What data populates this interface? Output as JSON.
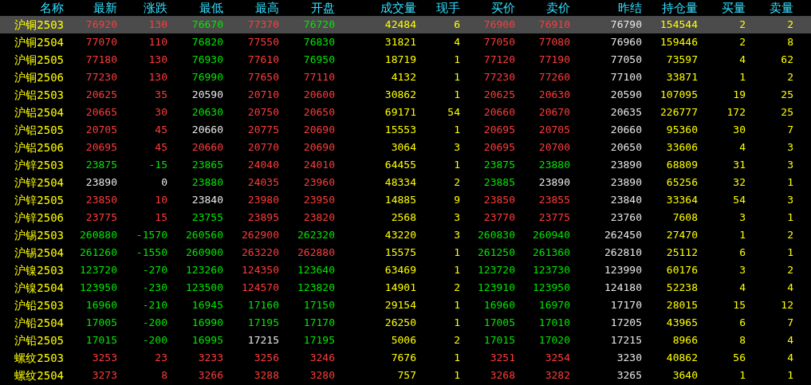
{
  "columns": [
    "名称",
    "最新",
    "涨跌",
    "最低",
    "最高",
    "开盘",
    "成交量",
    "现手",
    "买价",
    "卖价",
    "昨结",
    "持仓量",
    "买量",
    "卖量"
  ],
  "rows": [
    {
      "name": "沪铜2503",
      "selected": true,
      "cells": [
        {
          "text": "76920",
          "color": "#ff3c3c"
        },
        {
          "text": "130",
          "color": "#ff3c3c"
        },
        {
          "text": "76670",
          "color": "#00e800"
        },
        {
          "text": "77370",
          "color": "#ff3c3c"
        },
        {
          "text": "76720",
          "color": "#00e800"
        },
        {
          "text": "42484",
          "color": "#ffff00"
        },
        {
          "text": "6",
          "color": "#ffff00"
        },
        {
          "text": "76900",
          "color": "#ff3c3c"
        },
        {
          "text": "76910",
          "color": "#ff3c3c"
        },
        {
          "text": "76790",
          "color": "#e8e8e8"
        },
        {
          "text": "154544",
          "color": "#ffff00"
        },
        {
          "text": "2",
          "color": "#ffff00"
        },
        {
          "text": "2",
          "color": "#ffff00"
        }
      ]
    },
    {
      "name": "沪铜2504",
      "selected": false,
      "cells": [
        {
          "text": "77070",
          "color": "#ff3c3c"
        },
        {
          "text": "110",
          "color": "#ff3c3c"
        },
        {
          "text": "76820",
          "color": "#00e800"
        },
        {
          "text": "77550",
          "color": "#ff3c3c"
        },
        {
          "text": "76830",
          "color": "#00e800"
        },
        {
          "text": "31821",
          "color": "#ffff00"
        },
        {
          "text": "4",
          "color": "#ffff00"
        },
        {
          "text": "77050",
          "color": "#ff3c3c"
        },
        {
          "text": "77080",
          "color": "#ff3c3c"
        },
        {
          "text": "76960",
          "color": "#e8e8e8"
        },
        {
          "text": "159446",
          "color": "#ffff00"
        },
        {
          "text": "2",
          "color": "#ffff00"
        },
        {
          "text": "8",
          "color": "#ffff00"
        }
      ]
    },
    {
      "name": "沪铜2505",
      "selected": false,
      "cells": [
        {
          "text": "77180",
          "color": "#ff3c3c"
        },
        {
          "text": "130",
          "color": "#ff3c3c"
        },
        {
          "text": "76930",
          "color": "#00e800"
        },
        {
          "text": "77610",
          "color": "#ff3c3c"
        },
        {
          "text": "76950",
          "color": "#00e800"
        },
        {
          "text": "18719",
          "color": "#ffff00"
        },
        {
          "text": "1",
          "color": "#ffff00"
        },
        {
          "text": "77120",
          "color": "#ff3c3c"
        },
        {
          "text": "77190",
          "color": "#ff3c3c"
        },
        {
          "text": "77050",
          "color": "#e8e8e8"
        },
        {
          "text": "73597",
          "color": "#ffff00"
        },
        {
          "text": "4",
          "color": "#ffff00"
        },
        {
          "text": "62",
          "color": "#ffff00"
        }
      ]
    },
    {
      "name": "沪铜2506",
      "selected": false,
      "cells": [
        {
          "text": "77230",
          "color": "#ff3c3c"
        },
        {
          "text": "130",
          "color": "#ff3c3c"
        },
        {
          "text": "76990",
          "color": "#00e800"
        },
        {
          "text": "77650",
          "color": "#ff3c3c"
        },
        {
          "text": "77110",
          "color": "#ff3c3c"
        },
        {
          "text": "4132",
          "color": "#ffff00"
        },
        {
          "text": "1",
          "color": "#ffff00"
        },
        {
          "text": "77230",
          "color": "#ff3c3c"
        },
        {
          "text": "77260",
          "color": "#ff3c3c"
        },
        {
          "text": "77100",
          "color": "#e8e8e8"
        },
        {
          "text": "33871",
          "color": "#ffff00"
        },
        {
          "text": "1",
          "color": "#ffff00"
        },
        {
          "text": "2",
          "color": "#ffff00"
        }
      ]
    },
    {
      "name": "沪铝2503",
      "selected": false,
      "cells": [
        {
          "text": "20625",
          "color": "#ff3c3c"
        },
        {
          "text": "35",
          "color": "#ff3c3c"
        },
        {
          "text": "20590",
          "color": "#e8e8e8"
        },
        {
          "text": "20710",
          "color": "#ff3c3c"
        },
        {
          "text": "20600",
          "color": "#ff3c3c"
        },
        {
          "text": "30862",
          "color": "#ffff00"
        },
        {
          "text": "1",
          "color": "#ffff00"
        },
        {
          "text": "20625",
          "color": "#ff3c3c"
        },
        {
          "text": "20630",
          "color": "#ff3c3c"
        },
        {
          "text": "20590",
          "color": "#e8e8e8"
        },
        {
          "text": "107095",
          "color": "#ffff00"
        },
        {
          "text": "19",
          "color": "#ffff00"
        },
        {
          "text": "25",
          "color": "#ffff00"
        }
      ]
    },
    {
      "name": "沪铝2504",
      "selected": false,
      "cells": [
        {
          "text": "20665",
          "color": "#ff3c3c"
        },
        {
          "text": "30",
          "color": "#ff3c3c"
        },
        {
          "text": "20630",
          "color": "#00e800"
        },
        {
          "text": "20750",
          "color": "#ff3c3c"
        },
        {
          "text": "20650",
          "color": "#ff3c3c"
        },
        {
          "text": "69171",
          "color": "#ffff00"
        },
        {
          "text": "54",
          "color": "#ffff00"
        },
        {
          "text": "20660",
          "color": "#ff3c3c"
        },
        {
          "text": "20670",
          "color": "#ff3c3c"
        },
        {
          "text": "20635",
          "color": "#e8e8e8"
        },
        {
          "text": "226777",
          "color": "#ffff00"
        },
        {
          "text": "172",
          "color": "#ffff00"
        },
        {
          "text": "25",
          "color": "#ffff00"
        }
      ]
    },
    {
      "name": "沪铝2505",
      "selected": false,
      "cells": [
        {
          "text": "20705",
          "color": "#ff3c3c"
        },
        {
          "text": "45",
          "color": "#ff3c3c"
        },
        {
          "text": "20660",
          "color": "#e8e8e8"
        },
        {
          "text": "20775",
          "color": "#ff3c3c"
        },
        {
          "text": "20690",
          "color": "#ff3c3c"
        },
        {
          "text": "15553",
          "color": "#ffff00"
        },
        {
          "text": "1",
          "color": "#ffff00"
        },
        {
          "text": "20695",
          "color": "#ff3c3c"
        },
        {
          "text": "20705",
          "color": "#ff3c3c"
        },
        {
          "text": "20660",
          "color": "#e8e8e8"
        },
        {
          "text": "95360",
          "color": "#ffff00"
        },
        {
          "text": "30",
          "color": "#ffff00"
        },
        {
          "text": "7",
          "color": "#ffff00"
        }
      ]
    },
    {
      "name": "沪铝2506",
      "selected": false,
      "cells": [
        {
          "text": "20695",
          "color": "#ff3c3c"
        },
        {
          "text": "45",
          "color": "#ff3c3c"
        },
        {
          "text": "20660",
          "color": "#ff3c3c"
        },
        {
          "text": "20770",
          "color": "#ff3c3c"
        },
        {
          "text": "20690",
          "color": "#ff3c3c"
        },
        {
          "text": "3064",
          "color": "#ffff00"
        },
        {
          "text": "3",
          "color": "#ffff00"
        },
        {
          "text": "20695",
          "color": "#ff3c3c"
        },
        {
          "text": "20700",
          "color": "#ff3c3c"
        },
        {
          "text": "20650",
          "color": "#e8e8e8"
        },
        {
          "text": "33606",
          "color": "#ffff00"
        },
        {
          "text": "4",
          "color": "#ffff00"
        },
        {
          "text": "3",
          "color": "#ffff00"
        }
      ]
    },
    {
      "name": "沪锌2503",
      "selected": false,
      "cells": [
        {
          "text": "23875",
          "color": "#00e800"
        },
        {
          "text": "-15",
          "color": "#00e800"
        },
        {
          "text": "23865",
          "color": "#00e800"
        },
        {
          "text": "24040",
          "color": "#ff3c3c"
        },
        {
          "text": "24010",
          "color": "#ff3c3c"
        },
        {
          "text": "64455",
          "color": "#ffff00"
        },
        {
          "text": "1",
          "color": "#ffff00"
        },
        {
          "text": "23875",
          "color": "#00e800"
        },
        {
          "text": "23880",
          "color": "#00e800"
        },
        {
          "text": "23890",
          "color": "#e8e8e8"
        },
        {
          "text": "68809",
          "color": "#ffff00"
        },
        {
          "text": "31",
          "color": "#ffff00"
        },
        {
          "text": "3",
          "color": "#ffff00"
        }
      ]
    },
    {
      "name": "沪锌2504",
      "selected": false,
      "cells": [
        {
          "text": "23890",
          "color": "#e8e8e8"
        },
        {
          "text": "0",
          "color": "#e8e8e8"
        },
        {
          "text": "23880",
          "color": "#00e800"
        },
        {
          "text": "24035",
          "color": "#ff3c3c"
        },
        {
          "text": "23960",
          "color": "#ff3c3c"
        },
        {
          "text": "48334",
          "color": "#ffff00"
        },
        {
          "text": "2",
          "color": "#ffff00"
        },
        {
          "text": "23885",
          "color": "#00e800"
        },
        {
          "text": "23890",
          "color": "#e8e8e8"
        },
        {
          "text": "23890",
          "color": "#e8e8e8"
        },
        {
          "text": "65256",
          "color": "#ffff00"
        },
        {
          "text": "32",
          "color": "#ffff00"
        },
        {
          "text": "1",
          "color": "#ffff00"
        }
      ]
    },
    {
      "name": "沪锌2505",
      "selected": false,
      "cells": [
        {
          "text": "23850",
          "color": "#ff3c3c"
        },
        {
          "text": "10",
          "color": "#ff3c3c"
        },
        {
          "text": "23840",
          "color": "#e8e8e8"
        },
        {
          "text": "23980",
          "color": "#ff3c3c"
        },
        {
          "text": "23950",
          "color": "#ff3c3c"
        },
        {
          "text": "14885",
          "color": "#ffff00"
        },
        {
          "text": "9",
          "color": "#ffff00"
        },
        {
          "text": "23850",
          "color": "#ff3c3c"
        },
        {
          "text": "23855",
          "color": "#ff3c3c"
        },
        {
          "text": "23840",
          "color": "#e8e8e8"
        },
        {
          "text": "33364",
          "color": "#ffff00"
        },
        {
          "text": "54",
          "color": "#ffff00"
        },
        {
          "text": "3",
          "color": "#ffff00"
        }
      ]
    },
    {
      "name": "沪锌2506",
      "selected": false,
      "cells": [
        {
          "text": "23775",
          "color": "#ff3c3c"
        },
        {
          "text": "15",
          "color": "#ff3c3c"
        },
        {
          "text": "23755",
          "color": "#00e800"
        },
        {
          "text": "23895",
          "color": "#ff3c3c"
        },
        {
          "text": "23820",
          "color": "#ff3c3c"
        },
        {
          "text": "2568",
          "color": "#ffff00"
        },
        {
          "text": "3",
          "color": "#ffff00"
        },
        {
          "text": "23770",
          "color": "#ff3c3c"
        },
        {
          "text": "23775",
          "color": "#ff3c3c"
        },
        {
          "text": "23760",
          "color": "#e8e8e8"
        },
        {
          "text": "7608",
          "color": "#ffff00"
        },
        {
          "text": "3",
          "color": "#ffff00"
        },
        {
          "text": "1",
          "color": "#ffff00"
        }
      ]
    },
    {
      "name": "沪锡2503",
      "selected": false,
      "cells": [
        {
          "text": "260880",
          "color": "#00e800"
        },
        {
          "text": "-1570",
          "color": "#00e800"
        },
        {
          "text": "260560",
          "color": "#00e800"
        },
        {
          "text": "262900",
          "color": "#ff3c3c"
        },
        {
          "text": "262320",
          "color": "#00e800"
        },
        {
          "text": "43220",
          "color": "#ffff00"
        },
        {
          "text": "3",
          "color": "#ffff00"
        },
        {
          "text": "260830",
          "color": "#00e800"
        },
        {
          "text": "260940",
          "color": "#00e800"
        },
        {
          "text": "262450",
          "color": "#e8e8e8"
        },
        {
          "text": "27470",
          "color": "#ffff00"
        },
        {
          "text": "1",
          "color": "#ffff00"
        },
        {
          "text": "2",
          "color": "#ffff00"
        }
      ]
    },
    {
      "name": "沪锡2504",
      "selected": false,
      "cells": [
        {
          "text": "261260",
          "color": "#00e800"
        },
        {
          "text": "-1550",
          "color": "#00e800"
        },
        {
          "text": "260900",
          "color": "#00e800"
        },
        {
          "text": "263220",
          "color": "#ff3c3c"
        },
        {
          "text": "262880",
          "color": "#ff3c3c"
        },
        {
          "text": "15575",
          "color": "#ffff00"
        },
        {
          "text": "1",
          "color": "#ffff00"
        },
        {
          "text": "261250",
          "color": "#00e800"
        },
        {
          "text": "261360",
          "color": "#00e800"
        },
        {
          "text": "262810",
          "color": "#e8e8e8"
        },
        {
          "text": "25112",
          "color": "#ffff00"
        },
        {
          "text": "6",
          "color": "#ffff00"
        },
        {
          "text": "1",
          "color": "#ffff00"
        }
      ]
    },
    {
      "name": "沪镍2503",
      "selected": false,
      "cells": [
        {
          "text": "123720",
          "color": "#00e800"
        },
        {
          "text": "-270",
          "color": "#00e800"
        },
        {
          "text": "123260",
          "color": "#00e800"
        },
        {
          "text": "124350",
          "color": "#ff3c3c"
        },
        {
          "text": "123640",
          "color": "#00e800"
        },
        {
          "text": "63469",
          "color": "#ffff00"
        },
        {
          "text": "1",
          "color": "#ffff00"
        },
        {
          "text": "123720",
          "color": "#00e800"
        },
        {
          "text": "123730",
          "color": "#00e800"
        },
        {
          "text": "123990",
          "color": "#e8e8e8"
        },
        {
          "text": "60176",
          "color": "#ffff00"
        },
        {
          "text": "3",
          "color": "#ffff00"
        },
        {
          "text": "2",
          "color": "#ffff00"
        }
      ]
    },
    {
      "name": "沪镍2504",
      "selected": false,
      "cells": [
        {
          "text": "123950",
          "color": "#00e800"
        },
        {
          "text": "-230",
          "color": "#00e800"
        },
        {
          "text": "123500",
          "color": "#00e800"
        },
        {
          "text": "124570",
          "color": "#ff3c3c"
        },
        {
          "text": "123820",
          "color": "#00e800"
        },
        {
          "text": "14901",
          "color": "#ffff00"
        },
        {
          "text": "2",
          "color": "#ffff00"
        },
        {
          "text": "123910",
          "color": "#00e800"
        },
        {
          "text": "123950",
          "color": "#00e800"
        },
        {
          "text": "124180",
          "color": "#e8e8e8"
        },
        {
          "text": "52238",
          "color": "#ffff00"
        },
        {
          "text": "4",
          "color": "#ffff00"
        },
        {
          "text": "4",
          "color": "#ffff00"
        }
      ]
    },
    {
      "name": "沪铅2503",
      "selected": false,
      "cells": [
        {
          "text": "16960",
          "color": "#00e800"
        },
        {
          "text": "-210",
          "color": "#00e800"
        },
        {
          "text": "16945",
          "color": "#00e800"
        },
        {
          "text": "17160",
          "color": "#00e800"
        },
        {
          "text": "17150",
          "color": "#00e800"
        },
        {
          "text": "29154",
          "color": "#ffff00"
        },
        {
          "text": "1",
          "color": "#ffff00"
        },
        {
          "text": "16960",
          "color": "#00e800"
        },
        {
          "text": "16970",
          "color": "#00e800"
        },
        {
          "text": "17170",
          "color": "#e8e8e8"
        },
        {
          "text": "28015",
          "color": "#ffff00"
        },
        {
          "text": "15",
          "color": "#ffff00"
        },
        {
          "text": "12",
          "color": "#ffff00"
        }
      ]
    },
    {
      "name": "沪铅2504",
      "selected": false,
      "cells": [
        {
          "text": "17005",
          "color": "#00e800"
        },
        {
          "text": "-200",
          "color": "#00e800"
        },
        {
          "text": "16990",
          "color": "#00e800"
        },
        {
          "text": "17195",
          "color": "#00e800"
        },
        {
          "text": "17170",
          "color": "#00e800"
        },
        {
          "text": "26250",
          "color": "#ffff00"
        },
        {
          "text": "1",
          "color": "#ffff00"
        },
        {
          "text": "17005",
          "color": "#00e800"
        },
        {
          "text": "17010",
          "color": "#00e800"
        },
        {
          "text": "17205",
          "color": "#e8e8e8"
        },
        {
          "text": "43965",
          "color": "#ffff00"
        },
        {
          "text": "6",
          "color": "#ffff00"
        },
        {
          "text": "7",
          "color": "#ffff00"
        }
      ]
    },
    {
      "name": "沪铅2505",
      "selected": false,
      "cells": [
        {
          "text": "17015",
          "color": "#00e800"
        },
        {
          "text": "-200",
          "color": "#00e800"
        },
        {
          "text": "16995",
          "color": "#00e800"
        },
        {
          "text": "17215",
          "color": "#e8e8e8"
        },
        {
          "text": "17195",
          "color": "#00e800"
        },
        {
          "text": "5006",
          "color": "#ffff00"
        },
        {
          "text": "2",
          "color": "#ffff00"
        },
        {
          "text": "17015",
          "color": "#00e800"
        },
        {
          "text": "17020",
          "color": "#00e800"
        },
        {
          "text": "17215",
          "color": "#e8e8e8"
        },
        {
          "text": "8966",
          "color": "#ffff00"
        },
        {
          "text": "8",
          "color": "#ffff00"
        },
        {
          "text": "4",
          "color": "#ffff00"
        }
      ]
    },
    {
      "name": "螺纹2503",
      "selected": false,
      "cells": [
        {
          "text": "3253",
          "color": "#ff3c3c"
        },
        {
          "text": "23",
          "color": "#ff3c3c"
        },
        {
          "text": "3233",
          "color": "#ff3c3c"
        },
        {
          "text": "3256",
          "color": "#ff3c3c"
        },
        {
          "text": "3246",
          "color": "#ff3c3c"
        },
        {
          "text": "7676",
          "color": "#ffff00"
        },
        {
          "text": "1",
          "color": "#ffff00"
        },
        {
          "text": "3251",
          "color": "#ff3c3c"
        },
        {
          "text": "3254",
          "color": "#ff3c3c"
        },
        {
          "text": "3230",
          "color": "#e8e8e8"
        },
        {
          "text": "40862",
          "color": "#ffff00"
        },
        {
          "text": "56",
          "color": "#ffff00"
        },
        {
          "text": "4",
          "color": "#ffff00"
        }
      ]
    },
    {
      "name": "螺纹2504",
      "selected": false,
      "cells": [
        {
          "text": "3273",
          "color": "#ff3c3c"
        },
        {
          "text": "8",
          "color": "#ff3c3c"
        },
        {
          "text": "3266",
          "color": "#ff3c3c"
        },
        {
          "text": "3288",
          "color": "#ff3c3c"
        },
        {
          "text": "3280",
          "color": "#ff3c3c"
        },
        {
          "text": "757",
          "color": "#ffff00"
        },
        {
          "text": "1",
          "color": "#ffff00"
        },
        {
          "text": "3268",
          "color": "#ff3c3c"
        },
        {
          "text": "3282",
          "color": "#ff3c3c"
        },
        {
          "text": "3265",
          "color": "#e8e8e8"
        },
        {
          "text": "3640",
          "color": "#ffff00"
        },
        {
          "text": "1",
          "color": "#ffff00"
        },
        {
          "text": "1",
          "color": "#ffff00"
        }
      ]
    }
  ]
}
